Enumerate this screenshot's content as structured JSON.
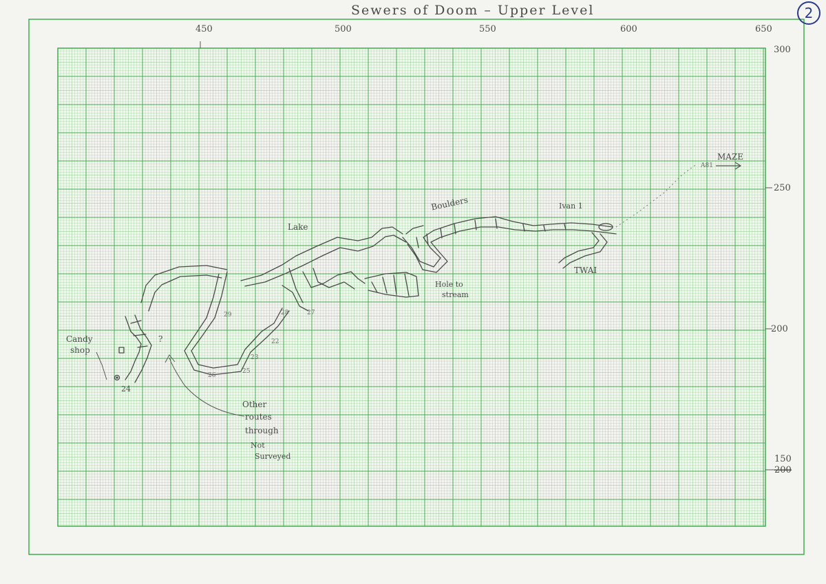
{
  "map": {
    "title": "Sewers of Doom – Upper Level",
    "page_number": "2",
    "x_axis_ticks": [
      "450",
      "500",
      "550",
      "600",
      "650"
    ],
    "y_axis_ticks": [
      "300",
      "250",
      "200",
      "150"
    ],
    "y_axis_struck_value": "200",
    "labels": {
      "candy_shop_line1": "Candy",
      "candy_shop_line2": "shop",
      "station_24": "24",
      "question_mark": "?",
      "lake": "Lake",
      "boulders": "Boulders",
      "hole_to_stream_line1": "Hole to",
      "hole_to_stream_line2": "stream",
      "ivan_1": "Ivan 1",
      "twai": "TWAI",
      "maze": "MAZE",
      "maze_station": "A81",
      "other_routes_line1": "Other",
      "other_routes_line2": "routes",
      "other_routes_line3": "through",
      "other_routes_line4": "Not",
      "other_routes_line5": "Surveyed"
    },
    "station_numbers": [
      "29",
      "26",
      "22",
      "23",
      "25",
      "27",
      "28"
    ],
    "colors": {
      "paper": "#f4f4f0",
      "grid_major": "#3fae4c",
      "grid_minor": "#a5d9a5",
      "pencil": "#4a4a4a",
      "page_circle": "#2a3a8a"
    }
  }
}
